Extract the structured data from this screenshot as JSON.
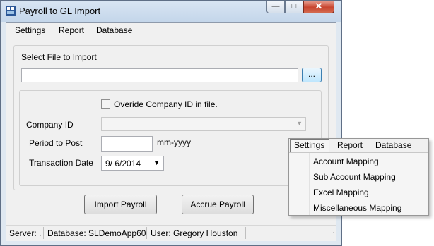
{
  "window": {
    "title": "Payroll to GL Import",
    "controls": {
      "minimize": "—",
      "maximize": "□",
      "close": "✕"
    },
    "close_color": "#c8452f"
  },
  "menu": {
    "settings": "Settings",
    "report": "Report",
    "database": "Database"
  },
  "form": {
    "select_file_label": "Select File to Import",
    "file_path_value": "",
    "browse_label": "...",
    "override_label": "Overide Company ID in file.",
    "override_checked": false,
    "company_id_label": "Company ID",
    "company_id_value": "",
    "period_label": "Period to Post",
    "period_value": "",
    "period_hint": "mm-yyyy",
    "transaction_date_label": "Transaction Date",
    "transaction_date_value": "9/  6/2014"
  },
  "buttons": {
    "import_payroll": "Import Payroll",
    "accrue_payroll": "Accrue Payroll"
  },
  "status": {
    "server": "Server: .",
    "database": "Database: SLDemoApp60",
    "user": "User: Gregory Houston"
  },
  "popup_menu": {
    "top": {
      "settings": "Settings",
      "report": "Report",
      "database": "Database"
    },
    "items": [
      "Account Mapping",
      "Sub Account Mapping",
      "Excel Mapping",
      "Miscellaneous Mapping"
    ]
  },
  "icons": {
    "app": "app-icon",
    "browse": "ellipsis-icon",
    "combo": "chevron-down-icon",
    "date": "chevron-down-icon",
    "grip": "resize-grip-icon"
  }
}
